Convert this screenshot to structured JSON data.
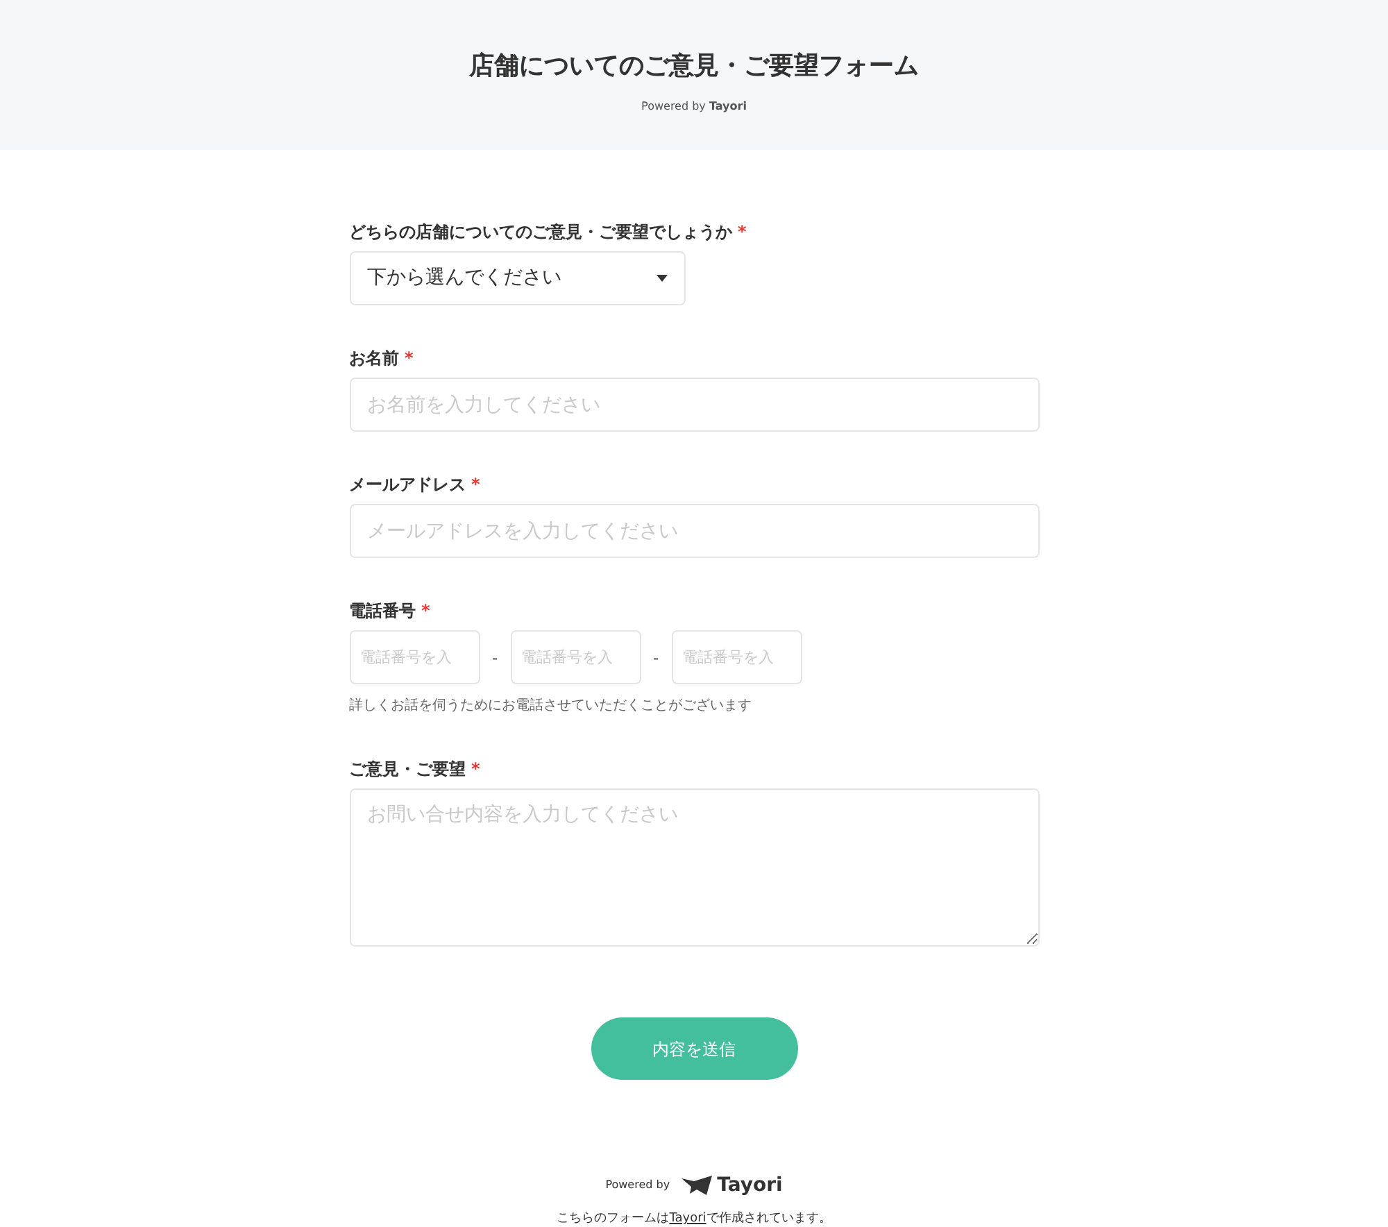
{
  "header": {
    "title": "店舗についてのご意見・ご要望フォーム",
    "powered_by": "Powered by **Tayori**"
  },
  "fields": [
    {
      "kind": "select",
      "label": "どちらの店舗についてのご意見・ご要望でしょうか",
      "required": true,
      "value": "下から選んでください"
    },
    {
      "kind": "text",
      "label": "お名前",
      "required": true,
      "placeholder": "お名前を入力してください"
    },
    {
      "kind": "text",
      "label": "メールアドレス",
      "required": true,
      "placeholder": "メールアドレスを入力してください"
    },
    {
      "kind": "phone",
      "label": "電話番号",
      "required": true,
      "parts": [
        {
          "placeholder": "電話番号を入"
        },
        {
          "placeholder": "電話番号を入"
        },
        {
          "placeholder": "電話番号を入"
        }
      ],
      "separator": "-",
      "help": "詳しくお話を伺うためにお電話させていただくことがございます"
    },
    {
      "kind": "textarea",
      "label": "ご意見・ご要望",
      "required": true,
      "placeholder": "お問い合せ内容を入力してください"
    }
  ],
  "required_mark": "*",
  "submit": "内容を送信",
  "footer": {
    "powered_by": "Powered by",
    "logo_text": "Tayori",
    "note_before": "こちらのフォームは",
    "note_link": "Tayori",
    "note_after": "で作成されています。"
  }
}
